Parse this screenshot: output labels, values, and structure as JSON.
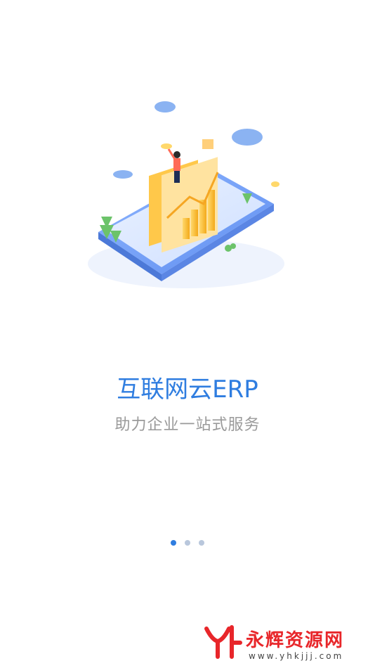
{
  "onboarding": {
    "title": "互联网云ERP",
    "subtitle": "助力企业一站式服务",
    "page_indicator": {
      "current": 1,
      "total": 3
    }
  },
  "illustration": {
    "icon": "erp-phone-chart-illustration"
  },
  "watermark": {
    "brand": "永辉资源网",
    "url": "www.yhkjjj.com"
  },
  "colors": {
    "accent": "#2f7de0",
    "subtitle": "#9a9a9a",
    "dot_inactive": "#b9c7dc",
    "watermark": "#e8262a"
  }
}
